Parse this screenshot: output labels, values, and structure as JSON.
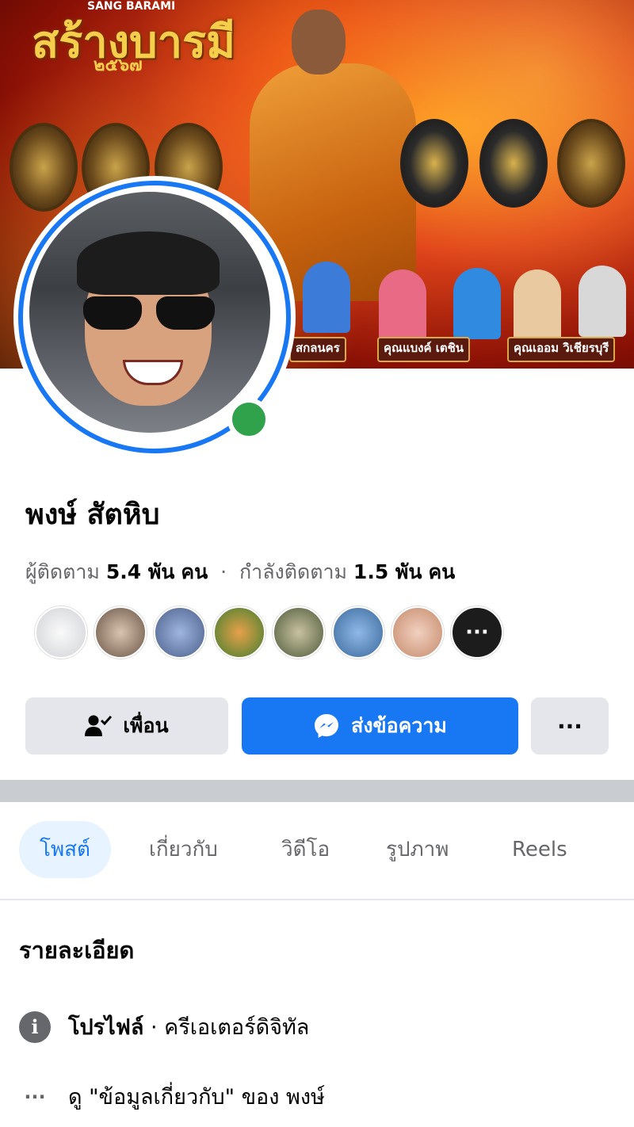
{
  "cover": {
    "title": "สร้างบารมี",
    "subtitle": "SANG BARAMI",
    "year": "๒๕๖๗",
    "labels": [
      "สกลนคร",
      "คุณแบงค์ เตชิน",
      "คุณเออม วิเชียรบุรี"
    ]
  },
  "profile": {
    "name": "พงษ์ สัตหิบ",
    "followers_label": "ผู้ติดตาม",
    "followers_value": "5.4 พัน",
    "followers_unit": "คน",
    "separator": "·",
    "following_label": "กำลังติดตาม",
    "following_value": "1.5 พัน",
    "following_unit": "คน"
  },
  "friends": {
    "count_shown": 7,
    "more_icon": "ellipsis-icon",
    "more_glyph": "···"
  },
  "actions": {
    "friend_label": "เพื่อน",
    "message_label": "ส่งข้อความ",
    "more_glyph": "···"
  },
  "tabs": [
    {
      "label": "โพสต์",
      "active": true
    },
    {
      "label": "เกี่ยวกับ",
      "active": false
    },
    {
      "label": "วิดีโอ",
      "active": false
    },
    {
      "label": "รูปภาพ",
      "active": false
    },
    {
      "label": "Reels",
      "active": false
    }
  ],
  "details": {
    "title": "รายละเอียด",
    "profile_label": "โปรไฟล์",
    "profile_sep": " · ",
    "profile_category": "ครีเอเตอร์ดิจิทัล",
    "about_link": "ดู \"ข้อมูลเกี่ยวกับ\" ของ พงษ์",
    "info_glyph": "i",
    "dots_glyph": "···"
  },
  "colors": {
    "accent": "#1877f2",
    "online": "#31a24c",
    "secondary_text": "#65676b",
    "button_gray": "#e4e6eb"
  }
}
